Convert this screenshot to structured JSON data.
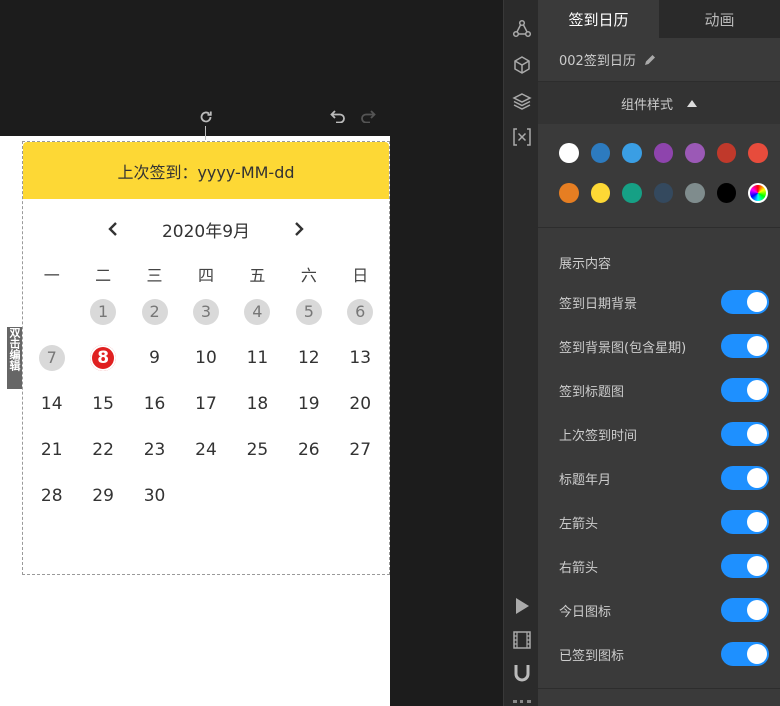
{
  "canvas": {
    "edit_tag": "双击编辑"
  },
  "widget": {
    "header_text": "上次签到：yyyy-MM-dd",
    "month_label": "2020年9月",
    "weekdays": [
      "一",
      "二",
      "三",
      "四",
      "五",
      "六",
      "日"
    ],
    "weeks": [
      [
        null,
        "1",
        "2",
        "3",
        "4",
        "5",
        "6"
      ],
      [
        "7",
        "8",
        "9",
        "10",
        "11",
        "12",
        "13"
      ],
      [
        "14",
        "15",
        "16",
        "17",
        "18",
        "19",
        "20"
      ],
      [
        "21",
        "22",
        "23",
        "24",
        "25",
        "26",
        "27"
      ],
      [
        "28",
        "29",
        "30",
        null,
        null,
        null,
        null
      ]
    ],
    "signed_days": [
      "1",
      "2",
      "3",
      "4",
      "5",
      "6",
      "7"
    ],
    "today": "8",
    "colors": {
      "header_bg": "#fdd835",
      "today": "#e02020",
      "signed": "#d9d9d9"
    }
  },
  "panel": {
    "tabs": [
      {
        "label": "签到日历",
        "active": true
      },
      {
        "label": "动画",
        "active": false
      }
    ],
    "component_name": "002签到日历",
    "style_section_label": "组件样式",
    "swatch_rows": [
      [
        "#ffffff",
        "#2d7bbf",
        "#3a9ee4",
        "#8e44ad",
        "#9b59b6",
        "#c0392b",
        "#e74c3c"
      ],
      [
        "#e67e22",
        "#fdd835",
        "#16a085",
        "#34495e",
        "#7f8c8d",
        "#000000",
        "picker"
      ]
    ],
    "content_title": "展示内容",
    "toggles": [
      {
        "label": "签到日期背景",
        "on": true
      },
      {
        "label": "签到背景图(包含星期)",
        "on": true
      },
      {
        "label": "签到标题图",
        "on": true
      },
      {
        "label": "上次签到时间",
        "on": true
      },
      {
        "label": "标题年月",
        "on": true
      },
      {
        "label": "左箭头",
        "on": true
      },
      {
        "label": "右箭头",
        "on": true
      },
      {
        "label": "今日图标",
        "on": true
      },
      {
        "label": "已签到图标",
        "on": true
      }
    ],
    "accent_color": "#1e90ff"
  },
  "icons": {
    "canvas_tools": [
      "refresh-icon",
      "undo-icon",
      "redo-icon"
    ],
    "iconbar_top": [
      "share-nodes-icon",
      "cube-icon",
      "layers-icon",
      "variable-icon"
    ],
    "iconbar_bottom": [
      "play-icon",
      "film-icon",
      "magnet-icon"
    ]
  }
}
